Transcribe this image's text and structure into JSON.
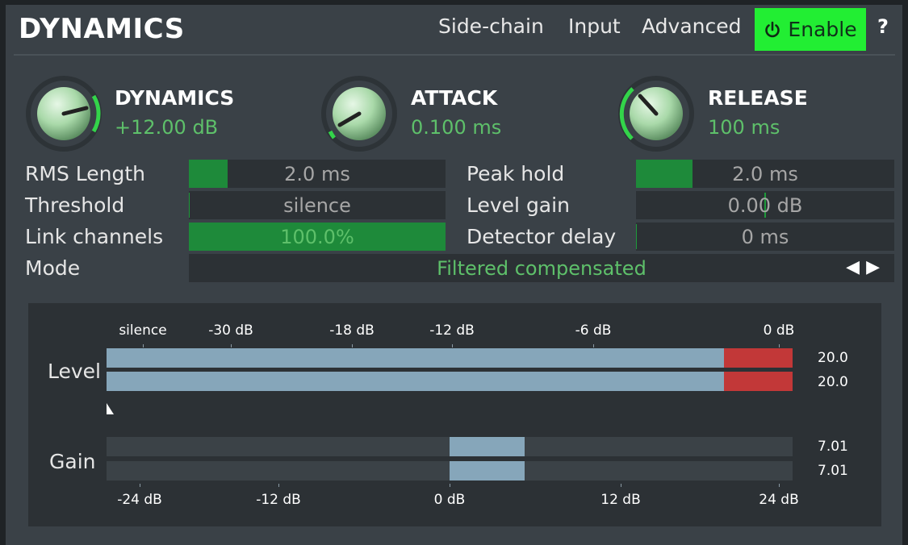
{
  "header": {
    "title": "DYNAMICS",
    "sidechain": "Side-chain",
    "input": "Input",
    "advanced": "Advanced",
    "enable": "Enable",
    "help": "?"
  },
  "knobs": {
    "dynamics": {
      "title": "DYNAMICS",
      "value": "+12.00 dB"
    },
    "attack": {
      "title": "ATTACK",
      "value": "0.100 ms"
    },
    "release": {
      "title": "RELEASE",
      "value": "100 ms"
    }
  },
  "params": {
    "rms_length": {
      "label": "RMS Length",
      "value": "2.0 ms",
      "level": 0.15
    },
    "threshold": {
      "label": "Threshold",
      "value": "silence",
      "level": 0.0
    },
    "link_channels": {
      "label": "Link channels",
      "value": "100.0%",
      "level": 1.0
    },
    "mode": {
      "label": "Mode",
      "value": "Filtered compensated"
    },
    "peak_hold": {
      "label": "Peak hold",
      "value": "2.0 ms",
      "level": 0.22
    },
    "level_gain": {
      "label": "Level gain",
      "value": "0.00 dB",
      "level": 0.5
    },
    "detector_delay": {
      "label": "Detector delay",
      "value": "0 ms",
      "level": 0.0
    }
  },
  "meters": {
    "level_label": "Level",
    "gain_label": "Gain",
    "level_scale": [
      "silence",
      "-30 dB",
      "-18 dB",
      "-12 dB",
      "-6 dB",
      "0 dB"
    ],
    "gain_scale": [
      "-24 dB",
      "-12 dB",
      "0 dB",
      "12 dB",
      "24 dB"
    ],
    "level_readouts": [
      "20.0",
      "20.0"
    ],
    "gain_readouts": [
      "7.01",
      "7.01"
    ]
  },
  "colors": {
    "accent_green": "#22ee33",
    "value_green": "#5ec06a",
    "meter_blue": "#86a6ba",
    "meter_red": "#c23838"
  },
  "icons": {
    "enable": "power-icon",
    "mode_prev": "arrow-left-icon",
    "mode_next": "arrow-right-icon"
  }
}
